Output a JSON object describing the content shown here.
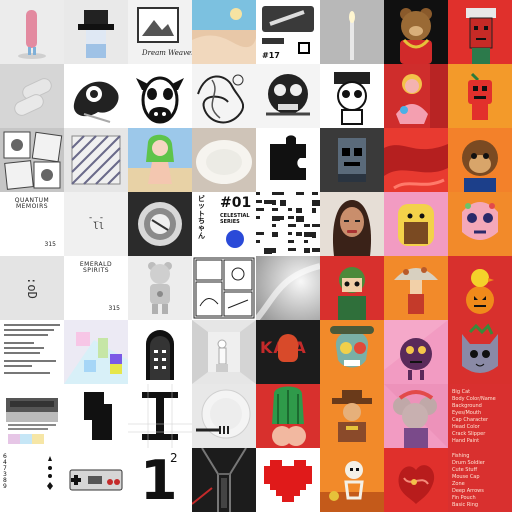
{
  "tiles": [
    {
      "name": "nft-pink-figure",
      "bg": "#ececec",
      "icon": "figure-icon"
    },
    {
      "name": "nft-pixel-glasses",
      "bg": "#e9e9e9",
      "icon": "pixel-face-icon"
    },
    {
      "name": "nft-dream-weaver",
      "bg": "#f2f2f2",
      "icon": "landscape-icon",
      "caption": "Dream Weaver"
    },
    {
      "name": "nft-pastel-desert",
      "bg": "#86c9df",
      "icon": "landscape-icon"
    },
    {
      "name": "nft-metro-card",
      "bg": "#ffffff",
      "icon": "card-icon",
      "caption": "#17"
    },
    {
      "name": "nft-candle-light",
      "bg": "#bdbdbd",
      "icon": "candle-icon"
    },
    {
      "name": "nft-bear-chains",
      "bg": "#101010",
      "icon": "bear-icon"
    },
    {
      "name": "nft-red-cap-head",
      "bg": "#e0302c",
      "icon": "head-icon"
    },
    {
      "name": "nft-embossed-pebbles",
      "bg": "#d8d8d8",
      "icon": "pebble-icon"
    },
    {
      "name": "nft-ink-splash",
      "bg": "#ffffff",
      "icon": "splash-icon"
    },
    {
      "name": "nft-cow-face",
      "bg": "#ffffff",
      "icon": "cow-icon"
    },
    {
      "name": "nft-doodle-swirl",
      "bg": "#f4f4f4",
      "icon": "doodle-icon"
    },
    {
      "name": "nft-skull-mask",
      "bg": "#f4f4f4",
      "icon": "skull-icon"
    },
    {
      "name": "nft-robot-cartoon",
      "bg": "#ffffff",
      "icon": "robot-icon"
    },
    {
      "name": "nft-pink-character",
      "bg": "#d9302f",
      "icon": "character-icon"
    },
    {
      "name": "nft-orange-bot",
      "bg": "#f28a20",
      "icon": "bot-icon"
    },
    {
      "name": "nft-stamp-collage",
      "bg": "#c8c8c8",
      "icon": "stamp-icon"
    },
    {
      "name": "nft-diagonal-lines",
      "bg": "#e6e6e6",
      "icon": "lines-icon"
    },
    {
      "name": "nft-green-hair-girl",
      "bg": "#9ec7e8",
      "icon": "character-icon"
    },
    {
      "name": "nft-white-plate",
      "bg": "#cfc6bd",
      "icon": "plate-icon"
    },
    {
      "name": "nft-puzzle-piece",
      "bg": "#ffffff",
      "icon": "puzzle-icon"
    },
    {
      "name": "nft-pixel-ghost",
      "bg": "#2f2f2f",
      "icon": "pixel-face-icon"
    },
    {
      "name": "nft-red-ink",
      "bg": "#e23a32",
      "icon": "splash-icon"
    },
    {
      "name": "nft-ape-portrait",
      "bg": "#f47a24",
      "icon": "ape-icon"
    },
    {
      "name": "nft-quantum-memoirs",
      "bg": "#ffffff",
      "icon": "book-icon",
      "title": "QUANTUM\nMEMOIRS",
      "num": "315"
    },
    {
      "name": "nft-face-emoticon",
      "bg": "#f0f0f0",
      "icon": "face-icon",
      "face": "-_-\n ll"
    },
    {
      "name": "nft-glass-orb",
      "bg": "#2a2a2a",
      "icon": "orb-icon"
    },
    {
      "name": "nft-bitchan-poster",
      "bg": "#ffffff",
      "icon": "poster-icon",
      "big": "#01",
      "sub": "CELESTIAL\nSERIES",
      "jp": "ビ\nッ\nト\nち\nゃ\nん"
    },
    {
      "name": "nft-pixel-noise",
      "bg": "#ffffff",
      "icon": "noise-icon"
    },
    {
      "name": "nft-woman-portrait",
      "bg": "#e8e2dc",
      "icon": "portrait-icon"
    },
    {
      "name": "nft-toast-character",
      "bg": "#f4a0c4",
      "icon": "toast-icon"
    },
    {
      "name": "nft-sugar-skull",
      "bg": "#f47a24",
      "icon": "skull-icon"
    },
    {
      "name": "nft-emoticon-d",
      "bg": "#e4e4e4",
      "icon": "face-icon",
      "face": ":oD"
    },
    {
      "name": "nft-emerald-spirits",
      "bg": "#ffffff",
      "icon": "book-icon",
      "title": "EMERALD\nSPIRITS",
      "num": "315"
    },
    {
      "name": "nft-silver-bear",
      "bg": "#ececec",
      "icon": "bear-icon"
    },
    {
      "name": "nft-manga-page",
      "bg": "#ffffff",
      "icon": "manga-icon"
    },
    {
      "name": "nft-soft-gradient",
      "bg": "#dedede",
      "icon": "gradient-icon"
    },
    {
      "name": "nft-green-helmet",
      "bg": "#d9302f",
      "icon": "character-icon"
    },
    {
      "name": "nft-mushroom-guy",
      "bg": "#f47a24",
      "icon": "mushroom-icon"
    },
    {
      "name": "nft-pumpkin-chick",
      "bg": "#e0302c",
      "icon": "pumpkin-icon"
    },
    {
      "name": "nft-text-document",
      "bg": "#ffffff",
      "icon": "document-icon"
    },
    {
      "name": "nft-pastel-blocks",
      "bg": "#ececf4",
      "icon": "blocks-icon"
    },
    {
      "name": "nft-arch-door",
      "bg": "#ffffff",
      "icon": "arch-icon"
    },
    {
      "name": "nft-statue-room",
      "bg": "#e9e9e9",
      "icon": "statue-icon"
    },
    {
      "name": "nft-kaa-devil",
      "bg": "#1c1c1c",
      "icon": "devil-icon",
      "label": "KA A"
    },
    {
      "name": "nft-zombie-skull",
      "bg": "#f47a24",
      "icon": "skull-icon"
    },
    {
      "name": "nft-purple-blob",
      "bg": "#f4a0c4",
      "icon": "blob-icon"
    },
    {
      "name": "nft-grey-cat",
      "bg": "#e0302c",
      "icon": "cat-icon"
    },
    {
      "name": "nft-retro-computer",
      "bg": "#ffffff",
      "icon": "computer-icon"
    },
    {
      "name": "nft-black-shape",
      "bg": "#ffffff",
      "icon": "shape-icon"
    },
    {
      "name": "nft-i-beam",
      "bg": "#ffffff",
      "icon": "ibeam-icon"
    },
    {
      "name": "nft-plate-fork",
      "bg": "#e4e4e4",
      "icon": "fork-icon"
    },
    {
      "name": "nft-green-hair-back",
      "bg": "#e0302c",
      "icon": "character-icon"
    },
    {
      "name": "nft-cowboy-hat",
      "bg": "#f47a24",
      "icon": "character-icon"
    },
    {
      "name": "nft-mouse-hat",
      "bg": "#f4a0c4",
      "icon": "mouse-icon"
    },
    {
      "name": "nft-red-text-list",
      "bg": "#d9302f",
      "icon": "list-icon",
      "lines": [
        "Big Cat",
        "Body Color/Name",
        "Background",
        "Eyes/Mouth",
        "Cap Character",
        "Head Color",
        "Crack Slipper",
        "Hand Paint"
      ]
    },
    {
      "name": "nft-playing-card",
      "bg": "#ffffff",
      "icon": "card-icon",
      "caption": "6 4 7 3 8 9"
    },
    {
      "name": "nft-game-controller",
      "bg": "#ffffff",
      "icon": "controller-icon"
    },
    {
      "name": "nft-number-one",
      "bg": "#ffffff",
      "icon": "number-icon",
      "big": "1",
      "sup": "2"
    },
    {
      "name": "nft-dark-corridor",
      "bg": "#1e1e1e",
      "icon": "corridor-icon"
    },
    {
      "name": "nft-pixel-heart",
      "bg": "#ffffff",
      "icon": "heart-icon"
    },
    {
      "name": "nft-skeleton-scene",
      "bg": "#f47a24",
      "icon": "skeleton-icon"
    },
    {
      "name": "nft-red-doodle",
      "bg": "#e0302c",
      "icon": "doodle-icon"
    },
    {
      "name": "nft-red-menu",
      "bg": "#d9302f",
      "icon": "list-icon",
      "lines": [
        "Fishing",
        "Drum Soldier",
        "Cute Stuff",
        "Mouse Cap",
        "Zone",
        "Deep Arrows",
        "Fin Pouch",
        "Basic Ring"
      ]
    }
  ]
}
